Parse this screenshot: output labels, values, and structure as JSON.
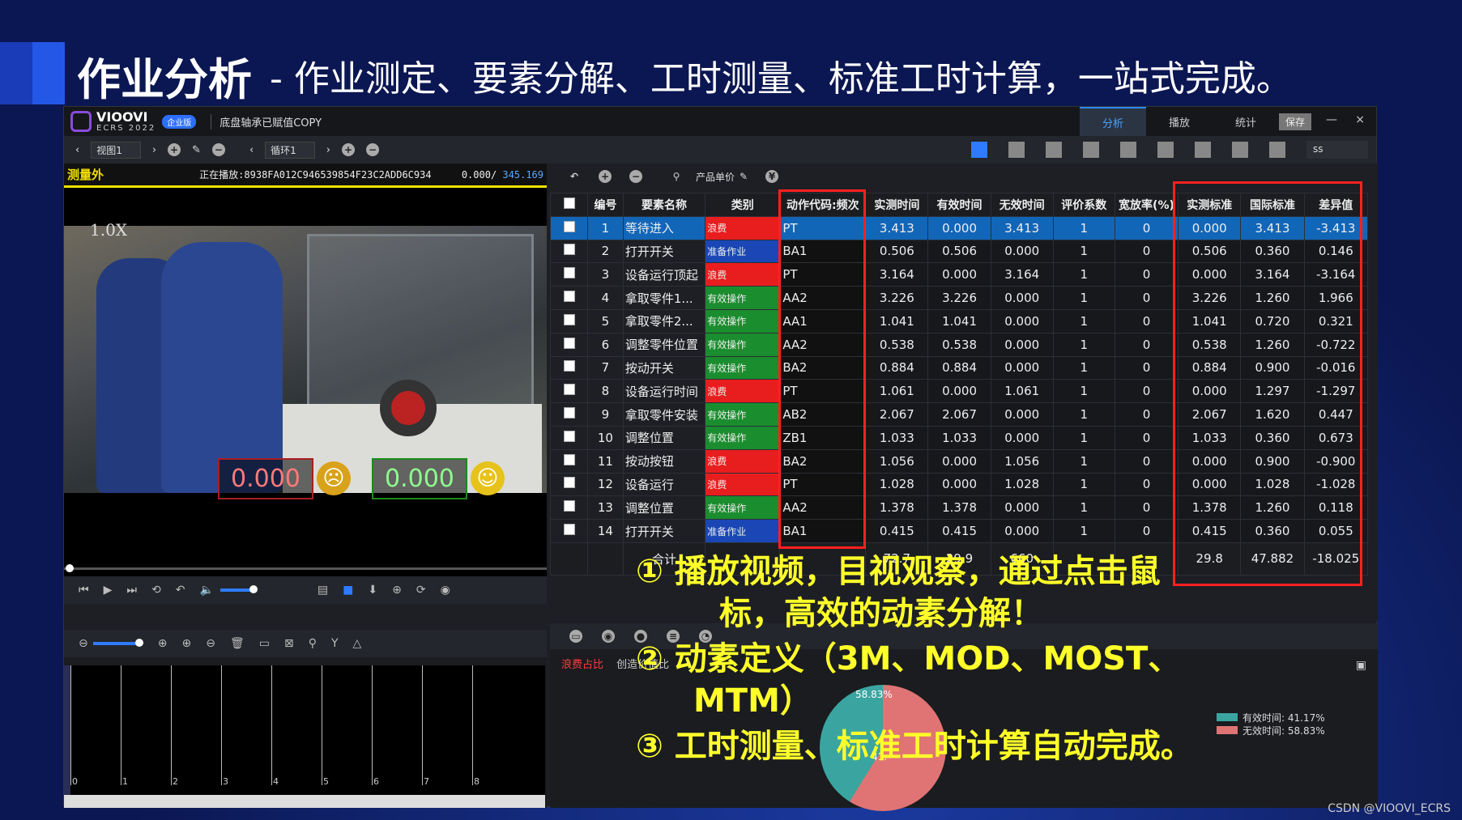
{
  "slide": {
    "title": "作业分析",
    "subtitle": "- 作业测定、要素分解、工时测量、标准工时计算，一站式完成。",
    "watermark": "CSDN @VIOOVI_ECRS"
  },
  "app": {
    "brand": "VIOOVI",
    "version": "ECRS 2022",
    "edition_badge": "企业版",
    "doc_name": "底盘轴承已赋值COPY",
    "tabs": [
      "分析",
      "播放",
      "统计"
    ],
    "active_tab": "分析",
    "save_label": "保存",
    "minimize": "—",
    "close": "×"
  },
  "toolbar": {
    "view_select": "视图1",
    "cycle_select": "循环1",
    "user_select": "ss"
  },
  "video": {
    "status_label": "测量外",
    "now_playing": "正在播放:8938FA012C9465398​54F23C2ADD6C934",
    "time_current": "0.000/",
    "time_total": "345.169",
    "speed": "1.0X",
    "waste_counter": "0.000",
    "effective_counter": "0.000"
  },
  "timeline": {
    "ticks": [
      "0",
      "1",
      "2",
      "3",
      "4",
      "5",
      "6",
      "7",
      "8"
    ]
  },
  "table_tools": {
    "product_price": "产品单价"
  },
  "table": {
    "headers": [
      "编号",
      "要素名称",
      "类别",
      "动作代码:频次",
      "实测时间",
      "有效时间",
      "无效时间",
      "评价系数",
      "宽放率(%)",
      "实测标准",
      "国际标准",
      "差异值"
    ],
    "rows": [
      {
        "no": "1",
        "name": "等待进入",
        "cat": "浪费",
        "type": "waste",
        "code": "PT",
        "t": "3.413",
        "eff": "0.000",
        "ineff": "3.413",
        "rate": "1",
        "allow": "0",
        "meas": "0.000",
        "intl": "3.413",
        "diff": "-3.413"
      },
      {
        "no": "2",
        "name": "打开开关",
        "cat": "准备作业",
        "type": "prep",
        "code": "BA1",
        "t": "0.506",
        "eff": "0.506",
        "ineff": "0.000",
        "rate": "1",
        "allow": "0",
        "meas": "0.506",
        "intl": "0.360",
        "diff": "0.146"
      },
      {
        "no": "3",
        "name": "设备运行顶起",
        "cat": "浪费",
        "type": "waste",
        "code": "PT",
        "t": "3.164",
        "eff": "0.000",
        "ineff": "3.164",
        "rate": "1",
        "allow": "0",
        "meas": "0.000",
        "intl": "3.164",
        "diff": "-3.164"
      },
      {
        "no": "4",
        "name": "拿取零件1...",
        "cat": "有效操作",
        "type": "eff",
        "code": "AA2",
        "t": "3.226",
        "eff": "3.226",
        "ineff": "0.000",
        "rate": "1",
        "allow": "0",
        "meas": "3.226",
        "intl": "1.260",
        "diff": "1.966"
      },
      {
        "no": "5",
        "name": "拿取零件2...",
        "cat": "有效操作",
        "type": "eff",
        "code": "AA1",
        "t": "1.041",
        "eff": "1.041",
        "ineff": "0.000",
        "rate": "1",
        "allow": "0",
        "meas": "1.041",
        "intl": "0.720",
        "diff": "0.321"
      },
      {
        "no": "6",
        "name": "调整零件位置",
        "cat": "有效操作",
        "type": "eff",
        "code": "AA2",
        "t": "0.538",
        "eff": "0.538",
        "ineff": "0.000",
        "rate": "1",
        "allow": "0",
        "meas": "0.538",
        "intl": "1.260",
        "diff": "-0.722"
      },
      {
        "no": "7",
        "name": "按动开关",
        "cat": "有效操作",
        "type": "eff",
        "code": "BA2",
        "t": "0.884",
        "eff": "0.884",
        "ineff": "0.000",
        "rate": "1",
        "allow": "0",
        "meas": "0.884",
        "intl": "0.900",
        "diff": "-0.016"
      },
      {
        "no": "8",
        "name": "设备运行时间",
        "cat": "浪费",
        "type": "waste",
        "code": "PT",
        "t": "1.061",
        "eff": "0.000",
        "ineff": "1.061",
        "rate": "1",
        "allow": "0",
        "meas": "0.000",
        "intl": "1.297",
        "diff": "-1.297"
      },
      {
        "no": "9",
        "name": "拿取零件安装",
        "cat": "有效操作",
        "type": "eff",
        "code": "AB2",
        "t": "2.067",
        "eff": "2.067",
        "ineff": "0.000",
        "rate": "1",
        "allow": "0",
        "meas": "2.067",
        "intl": "1.620",
        "diff": "0.447"
      },
      {
        "no": "10",
        "name": "调整位置",
        "cat": "有效操作",
        "type": "eff",
        "code": "ZB1",
        "t": "1.033",
        "eff": "1.033",
        "ineff": "0.000",
        "rate": "1",
        "allow": "0",
        "meas": "1.033",
        "intl": "0.360",
        "diff": "0.673"
      },
      {
        "no": "11",
        "name": "按动按钮",
        "cat": "浪费",
        "type": "waste",
        "code": "BA2",
        "t": "1.056",
        "eff": "0.000",
        "ineff": "1.056",
        "rate": "1",
        "allow": "0",
        "meas": "0.000",
        "intl": "0.900",
        "diff": "-0.900"
      },
      {
        "no": "12",
        "name": "设备运行",
        "cat": "浪费",
        "type": "waste",
        "code": "PT",
        "t": "1.028",
        "eff": "0.000",
        "ineff": "1.028",
        "rate": "1",
        "allow": "0",
        "meas": "0.000",
        "intl": "1.028",
        "diff": "-1.028"
      },
      {
        "no": "13",
        "name": "调整位置",
        "cat": "有效操作",
        "type": "eff",
        "code": "AA2",
        "t": "1.378",
        "eff": "1.378",
        "ineff": "0.000",
        "rate": "1",
        "allow": "0",
        "meas": "1.378",
        "intl": "1.260",
        "diff": "0.118"
      },
      {
        "no": "14",
        "name": "打开开关",
        "cat": "准备作业",
        "type": "prep",
        "code": "BA1",
        "t": "0.415",
        "eff": "0.415",
        "ineff": "0.000",
        "rate": "1",
        "allow": "0",
        "meas": "0.415",
        "intl": "0.360",
        "diff": "0.055"
      }
    ],
    "summary": {
      "label": "合计",
      "t": "72.7",
      "eff": "29.9",
      "ineff": "660",
      "meas": "29.8",
      "intl": "47.882",
      "diff": "-18.025"
    }
  },
  "analysis": {
    "tab_waste": "浪费占比",
    "tab_value": "创造价值比",
    "pie_waste_label": "58.83%",
    "pie_eff_label": "41.",
    "legend": [
      {
        "label": "有效时间: 41.17%",
        "color": "#3aa5a0"
      },
      {
        "label": "无效时间: 58.83%",
        "color": "#e07474"
      }
    ]
  },
  "annotations": [
    "① 播放视频，目视观察，通过点击鼠",
    "标，高效的动素分解！",
    "② 动素定义（3M、MOD、MOST、",
    "MTM）",
    "③ 工时测量、标准工时计算自动完成。"
  ],
  "chart_data": {
    "type": "pie",
    "labels": [
      "有效时间",
      "无效时间"
    ],
    "values": [
      41.17,
      58.83
    ],
    "colors": [
      "#3aa5a0",
      "#e07474"
    ],
    "title": ""
  }
}
